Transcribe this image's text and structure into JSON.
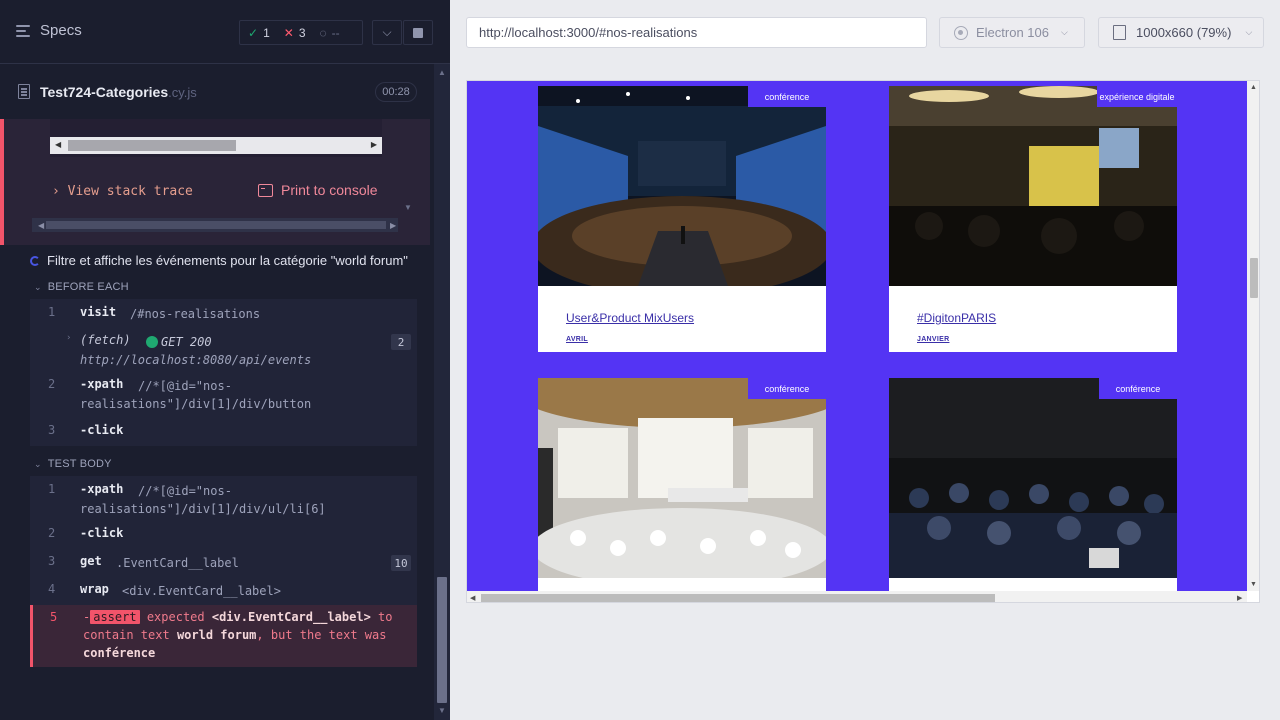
{
  "reporter": {
    "specs_label": "Specs",
    "stats": {
      "passed": "1",
      "failed": "3",
      "pending": "--"
    },
    "spec": {
      "name": "Test724-Categories",
      "ext": ".cy.js",
      "duration": "00:28"
    },
    "error": {
      "view_stack_trace": "View stack trace",
      "print_to_console": "Print to console"
    },
    "test_title": "Filtre et affiche les événements pour la catégorie \"world forum\"",
    "before_each": {
      "label": "BEFORE EACH",
      "commands": [
        {
          "num": "1",
          "name": "visit",
          "message": "/#nos-realisations"
        },
        {
          "num": "",
          "name": "(fetch)",
          "message_status": "GET 200",
          "message_url": "http://localhost:8080/api/events",
          "badge": "2"
        },
        {
          "num": "2",
          "name": "-xpath",
          "message_line1": "//*[@id=\"nos-",
          "message_line2": "realisations\"]/div[1]/div/button"
        },
        {
          "num": "3",
          "name": "-click"
        }
      ]
    },
    "test_body": {
      "label": "TEST BODY",
      "commands": [
        {
          "num": "1",
          "name": "-xpath",
          "message_line1": "//*[@id=\"nos-",
          "message_line2": "realisations\"]/div[1]/div/ul/li[6]"
        },
        {
          "num": "2",
          "name": "-click"
        },
        {
          "num": "3",
          "name": "get",
          "message": ".EventCard__label",
          "badge": "10"
        },
        {
          "num": "4",
          "name": "wrap",
          "message": "<div.EventCard__label>"
        },
        {
          "num": "5",
          "prefix": "-",
          "assert_label": "assert",
          "text_1": "expected",
          "subject": "<div.EventCard__label>",
          "text_2": "to contain text",
          "expected_value": "world forum",
          "text_3": ", but the text was",
          "actual_value": "conférence"
        }
      ]
    }
  },
  "aut": {
    "url": "http://localhost:3000/#nos-realisations",
    "browser": "Electron 106",
    "viewport": "1000x660",
    "scale": "(79%)",
    "cards": [
      {
        "tag": "conférence",
        "title": "User&Product MixUsers",
        "month": "avril"
      },
      {
        "tag": "expérience digitale",
        "title": "#DigitonPARIS",
        "month": "janvier"
      },
      {
        "tag": "conférence",
        "title": "",
        "month": ""
      },
      {
        "tag": "conférence",
        "title": "",
        "month": ""
      }
    ]
  },
  "colors": {
    "accent": "#5434f4",
    "fail": "#f2546a",
    "pass": "#1fa971"
  },
  "icons": [
    "menu-icon",
    "check-icon",
    "x-icon",
    "spinner-icon",
    "chevron-down-icon",
    "stop-icon",
    "file-icon",
    "console-icon",
    "electron-icon",
    "viewport-icon"
  ]
}
